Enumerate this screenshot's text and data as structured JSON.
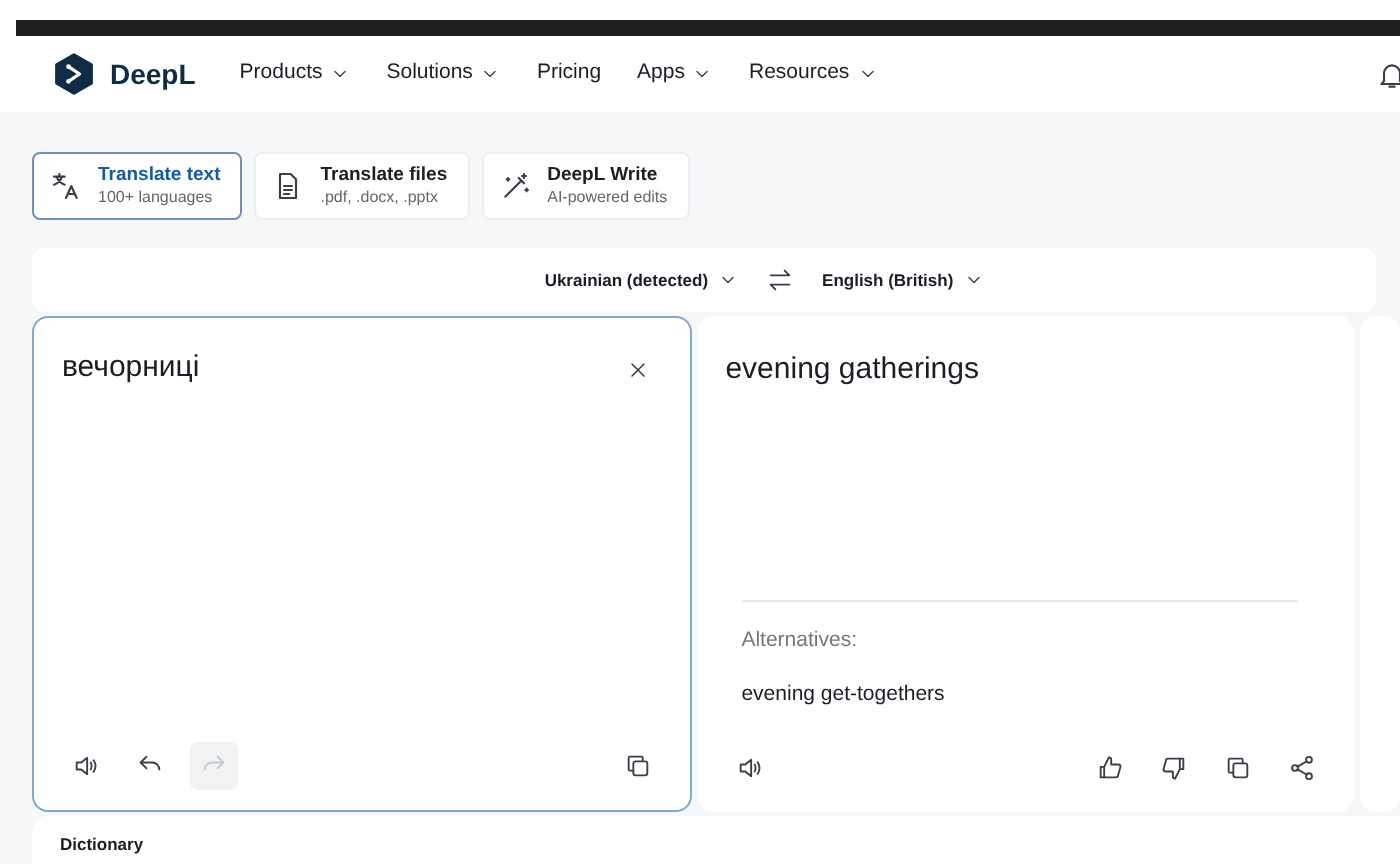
{
  "nav": {
    "brand": "DeepL",
    "items": [
      {
        "label": "Products",
        "dropdown": true
      },
      {
        "label": "Solutions",
        "dropdown": true
      },
      {
        "label": "Pricing",
        "dropdown": false
      },
      {
        "label": "Apps",
        "dropdown": true
      },
      {
        "label": "Resources",
        "dropdown": true
      }
    ]
  },
  "modes": [
    {
      "kind": "translate",
      "title": "Translate text",
      "subtitle": "100+ languages",
      "selected": true
    },
    {
      "kind": "files",
      "title": "Translate files",
      "subtitle": ".pdf, .docx, .pptx",
      "selected": false
    },
    {
      "kind": "write",
      "title": "DeepL Write",
      "subtitle": "AI-powered edits",
      "selected": false
    }
  ],
  "languages": {
    "source": "Ukrainian (detected)",
    "target": "English (British)"
  },
  "source": {
    "text": "вечорниці",
    "redo_disabled": true
  },
  "target": {
    "text": "evening gatherings",
    "alternatives_label": "Alternatives:",
    "alternatives": [
      "evening get-togethers"
    ]
  },
  "dictionary": {
    "title": "Dictionary"
  }
}
